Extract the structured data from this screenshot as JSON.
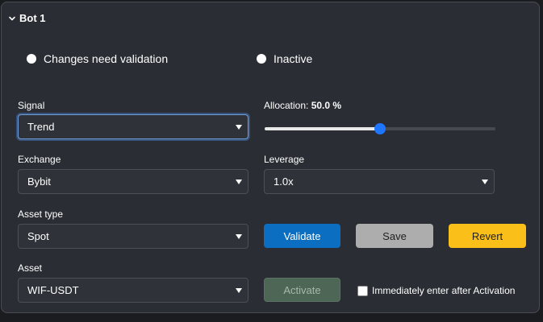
{
  "bot": {
    "title": "Bot 1",
    "status_validation": "Changes need validation",
    "status_active": "Inactive"
  },
  "fields": {
    "signal": {
      "label": "Signal",
      "value": "Trend"
    },
    "allocation": {
      "label_prefix": "Allocation: ",
      "value_text": "50.0 %",
      "fraction": 0.5
    },
    "exchange": {
      "label": "Exchange",
      "value": "Bybit"
    },
    "leverage": {
      "label": "Leverage",
      "value": "1.0x"
    },
    "asset_type": {
      "label": "Asset type",
      "value": "Spot"
    },
    "asset": {
      "label": "Asset",
      "value": "WIF-USDT"
    }
  },
  "buttons": {
    "validate": "Validate",
    "save": "Save",
    "revert": "Revert",
    "activate": "Activate"
  },
  "checkbox": {
    "label": "Immediately enter after Activation",
    "checked": false
  },
  "colors": {
    "accent": "#1e76ff",
    "validate": "#0b6ec0",
    "save": "#adadad",
    "revert": "#fbbf1a",
    "activate_disabled": "#4d6656"
  }
}
